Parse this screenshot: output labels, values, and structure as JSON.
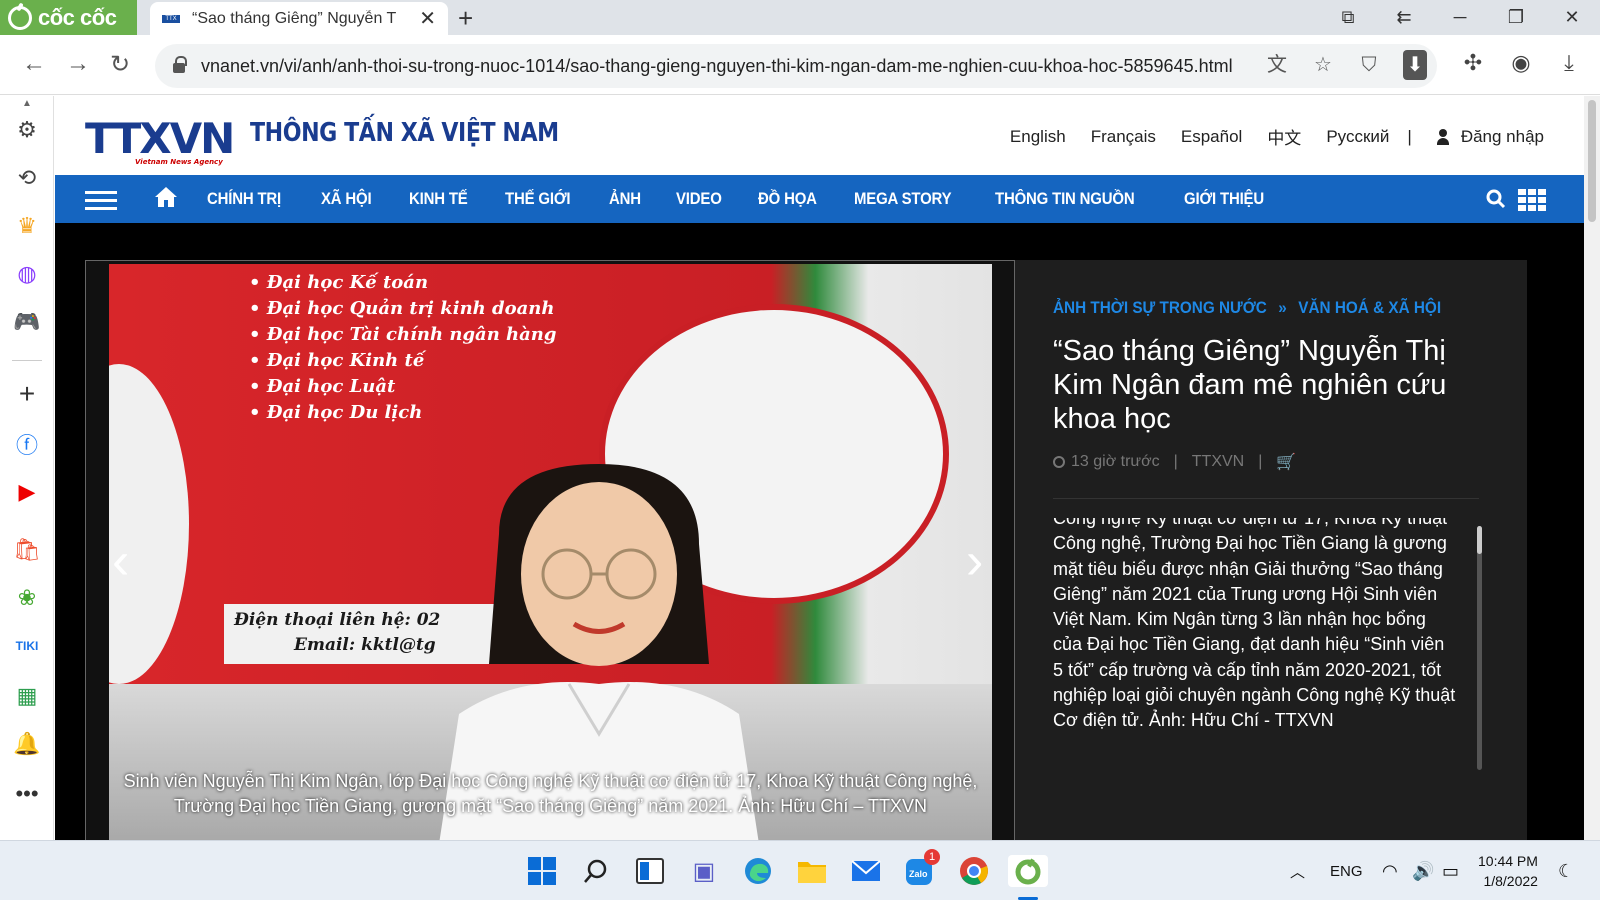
{
  "browser": {
    "brand": "cốc cốc",
    "tab_title": "“Sao tháng Giêng” Nguyễn T",
    "url": "vnanet.vn/vi/anh/anh-thoi-su-trong-nuoc-1014/sao-thang-gieng-nguyen-thi-kim-ngan-dam-me-nghien-cuu-khoa-hoc-5859645.html"
  },
  "site": {
    "logo": "TTXVN",
    "logo_sub": "Vietnam News Agency",
    "name": "THÔNG TẤN XÃ VIỆT NAM",
    "languages": [
      "English",
      "Français",
      "Español",
      "中文",
      "Русский"
    ],
    "separator": "|",
    "login": "Đăng nhập"
  },
  "nav": {
    "items": [
      "CHÍNH TRỊ",
      "XÃ HỘI",
      "KINH TẾ",
      "THẾ GIỚI",
      "ẢNH",
      "VIDEO",
      "ĐỒ HỌA",
      "MEGA STORY",
      "THÔNG TIN NGUỒN",
      "GIỚI THIỆU"
    ]
  },
  "photo": {
    "poster_lines": [
      "• Đại học Kế toán",
      "• Đại học Quản trị kinh doanh",
      "• Đại học Tài chính ngân hàng",
      "• Đại học Kinh tế",
      "• Đại học Luật",
      "• Đại học Du lịch"
    ],
    "poster_contact_1": "Điện thoại liên hệ: 02",
    "poster_contact_2": "Email: kktl@tg",
    "caption_1": "Sinh viên Nguyễn Thị Kim Ngân, lớp Đại học Công nghệ Kỹ thuật cơ điện tử 17, Khoa Kỹ thuật Công nghệ,",
    "caption_2": "Trường Đại học Tiền Giang, gương mặt “Sao tháng Giêng” năm 2021. Ảnh: Hữu Chí – TTXVN",
    "prev": "‹",
    "next": "›"
  },
  "article": {
    "breadcrumb_1": "ẢNH THỜI SỰ TRONG NƯỚC",
    "breadcrumb_sep": "»",
    "breadcrumb_2": "VĂN HOÁ & XÃ HỘI",
    "title": "“Sao tháng Giêng” Nguyễn Thị Kim Ngân đam mê nghiên cứu khoa học",
    "time": "13 giờ trước",
    "source": "TTXVN",
    "meta_sep": "|",
    "description": "Công nghệ Kỹ thuật cơ điện tử 17, Khoa Kỹ thuật Công nghệ, Trường Đại học Tiền Giang là gương mặt tiêu biểu được nhận Giải thưởng “Sao tháng Giêng” năm 2021 của Trung ương Hội Sinh viên Việt Nam. Kim Ngân từng 3 lần nhận học bổng của Đại học Tiền Giang, đạt danh hiệu “Sinh viên 5 tốt” cấp trường và cấp tỉnh năm 2020-2021, tốt nghiệp loại giỏi chuyên ngành Công nghệ Kỹ thuật Cơ điện tử. Ảnh: Hữu Chí - TTXVN"
  },
  "taskbar": {
    "language": "ENG",
    "time": "10:44 PM",
    "date": "1/8/2022",
    "zalo_badge": "1"
  },
  "colors": {
    "nav_blue": "#1565c0",
    "brand_green": "#6ab04c",
    "breadcrumb_blue": "#1e88e5",
    "logo_navy": "#1a3c8f"
  }
}
